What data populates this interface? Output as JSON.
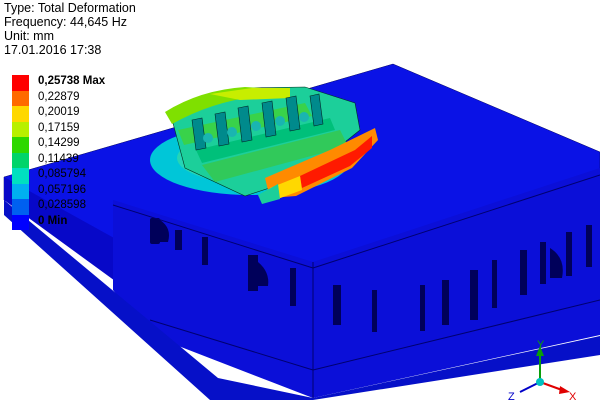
{
  "result": {
    "type_line": "Type: Total Deformation",
    "frequency_line": "Frequency: 44,645 Hz",
    "unit_line": "Unit: mm",
    "timestamp_line": "17.01.2016 17:38"
  },
  "legend": {
    "entries": [
      {
        "label": "0,25738 Max",
        "color": "#ff0000",
        "emphasis": true
      },
      {
        "label": "0,22879",
        "color": "#ff6a00",
        "emphasis": false
      },
      {
        "label": "0,20019",
        "color": "#ffd800",
        "emphasis": false
      },
      {
        "label": "0,17159",
        "color": "#b8f000",
        "emphasis": false
      },
      {
        "label": "0,14299",
        "color": "#2ed800",
        "emphasis": false
      },
      {
        "label": "0,11439",
        "color": "#00d46a",
        "emphasis": false
      },
      {
        "label": "0,085794",
        "color": "#00e0c0",
        "emphasis": false
      },
      {
        "label": "0,057196",
        "color": "#00b0f0",
        "emphasis": false
      },
      {
        "label": "0,028598",
        "color": "#0060f0",
        "emphasis": false
      },
      {
        "label": "0 Min",
        "color": "#0000ff",
        "emphasis": true
      }
    ]
  },
  "triad": {
    "y_label": "Y",
    "x_label": "X",
    "z_label": "Z"
  }
}
